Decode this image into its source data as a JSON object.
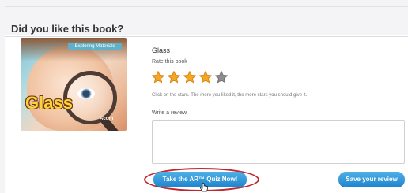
{
  "heading": "Did you like this book?",
  "book": {
    "title": "Glass",
    "cover": {
      "series_text": "Exploring Materials",
      "title_art": "Glass",
      "publisher": "Acorn"
    }
  },
  "rating": {
    "label": "Rate this book",
    "value": 4,
    "max": 5,
    "hint": "Click on the stars. The more you liked it, the more stars you should give it.",
    "filled_color": "#f5a623",
    "empty_color": "#8e8e8e"
  },
  "review": {
    "label": "Write a review",
    "value": "",
    "placeholder": ""
  },
  "buttons": {
    "quiz_label": "Take the AR™ Quiz Now!",
    "save_label": "Save your review"
  },
  "colors": {
    "button_blue": "#1f86cf",
    "highlight_ring": "#c0262d"
  }
}
